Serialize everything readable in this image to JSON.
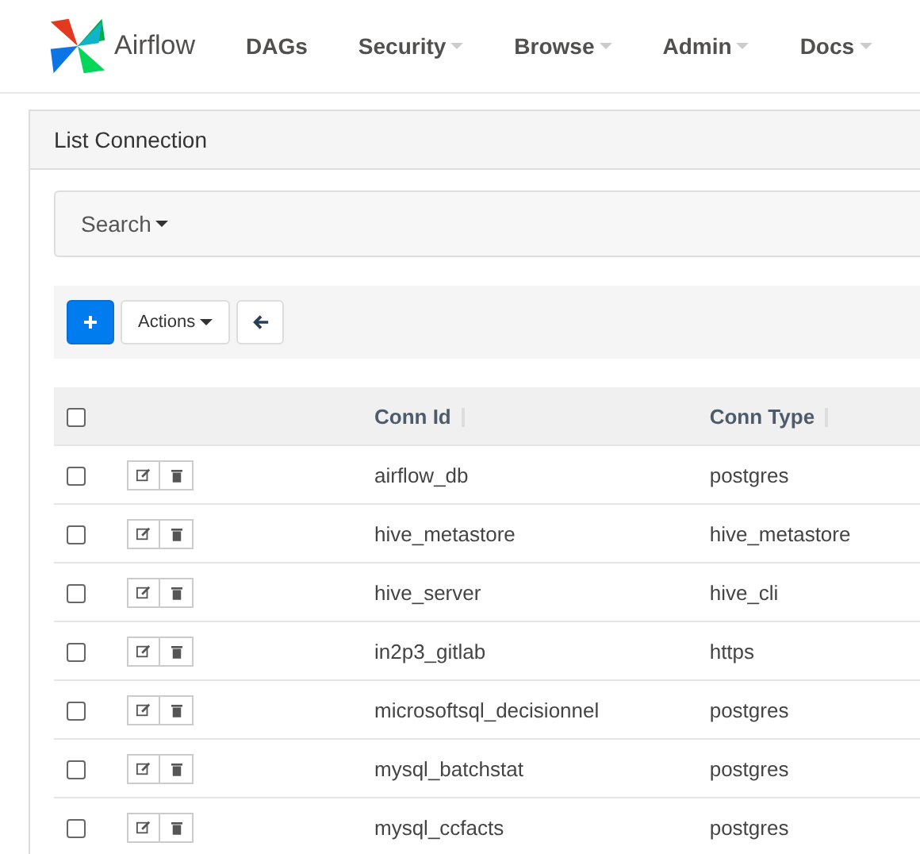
{
  "navbar": {
    "brand": "Airflow",
    "menu": [
      {
        "label": "DAGs",
        "dropdown": false
      },
      {
        "label": "Security",
        "dropdown": true
      },
      {
        "label": "Browse",
        "dropdown": true
      },
      {
        "label": "Admin",
        "dropdown": true
      },
      {
        "label": "Docs",
        "dropdown": true
      }
    ]
  },
  "panel": {
    "title": "List Connection"
  },
  "search": {
    "label": "Search"
  },
  "toolbar": {
    "actions_label": "Actions"
  },
  "table": {
    "columns": [
      "Conn Id",
      "Conn Type"
    ],
    "all_checked": false,
    "rows": [
      {
        "conn_id": "airflow_db",
        "conn_type": "postgres",
        "checked": false
      },
      {
        "conn_id": "hive_metastore",
        "conn_type": "hive_metastore",
        "checked": false
      },
      {
        "conn_id": "hive_server",
        "conn_type": "hive_cli",
        "checked": false
      },
      {
        "conn_id": "in2p3_gitlab",
        "conn_type": "https",
        "checked": false
      },
      {
        "conn_id": "microsoftsql_decisionnel",
        "conn_type": "postgres",
        "checked": false
      },
      {
        "conn_id": "mysql_batchstat",
        "conn_type": "postgres",
        "checked": false
      },
      {
        "conn_id": "mysql_ccfacts",
        "conn_type": "postgres",
        "checked": false
      }
    ]
  }
}
